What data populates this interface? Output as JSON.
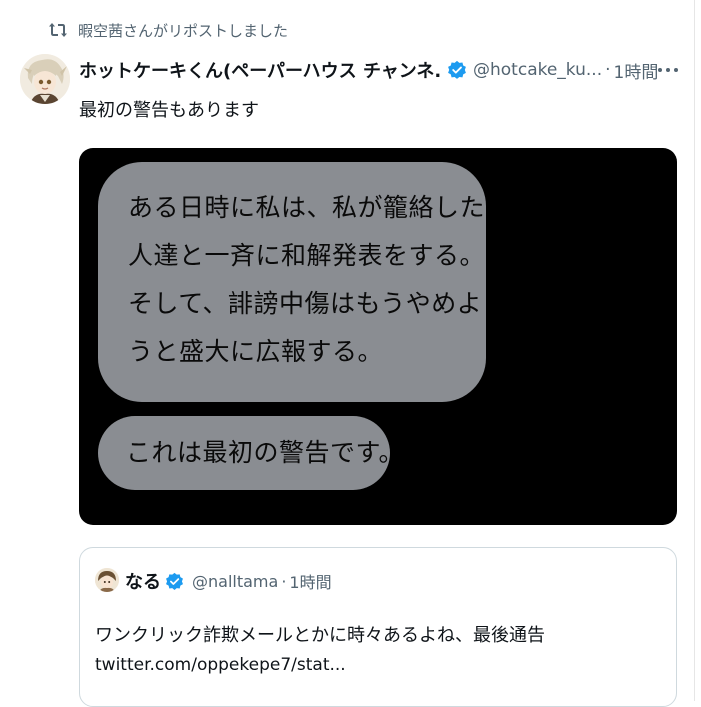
{
  "repost": {
    "icon": "repost-icon",
    "text": "暇空茜さんがリポストしました"
  },
  "tweet": {
    "author": {
      "avatar_icon": "avatar-anime-character",
      "display_name": "ホットケーキくん(ペーパーハウス チャンネ...",
      "verified_icon": "verified-badge-icon",
      "handle": "@hotcake_ku...",
      "separator": "·",
      "time": "1時間"
    },
    "more_icon": "more-options-icon",
    "text": "最初の警告もあります",
    "media": {
      "bubble_1_lines": [
        "ある日時に私は、私が籠絡した",
        "人達と一斉に和解発表をする。",
        "そして、誹謗中傷はもうやめよ",
        "うと盛大に広報する。"
      ],
      "bubble_2_text": "これは最初の警告です。"
    }
  },
  "quote": {
    "avatar_icon": "avatar-anime-character",
    "name": "なる",
    "verified_icon": "verified-badge-icon",
    "handle": "@nalltama",
    "separator": "·",
    "time": "1時間",
    "text": "ワンクリック詐欺メールとかに時々あるよね、最後通告",
    "link": "twitter.com/oppekepe7/stat..."
  },
  "colors": {
    "secondary_text": "#536471",
    "primary_text": "#0f1419",
    "verified_blue": "#1d9bf0",
    "media_background": "#000000",
    "bubble_gray": "#8a8d92",
    "card_border": "#cfd9de"
  }
}
